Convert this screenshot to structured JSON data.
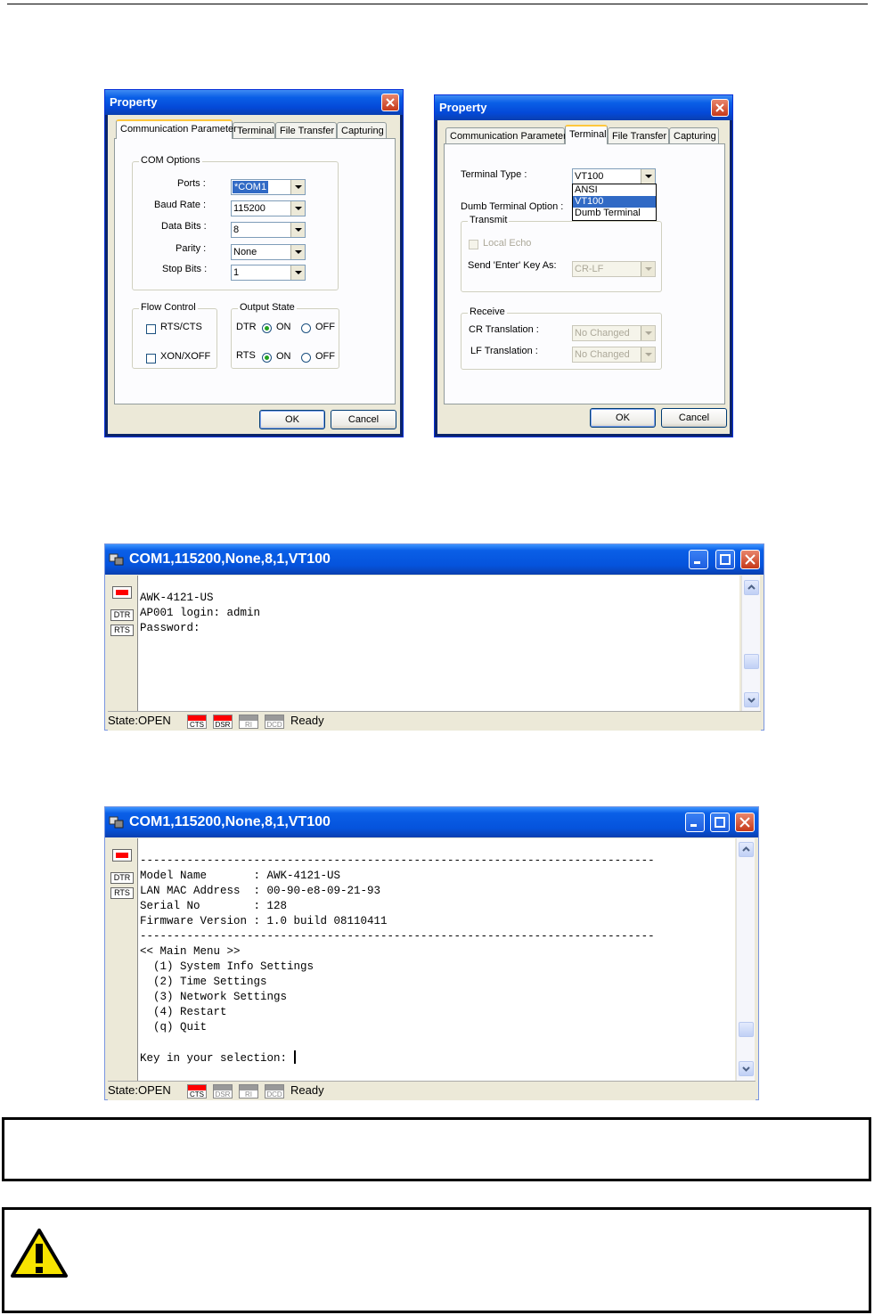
{
  "dialog1": {
    "title": "Property",
    "tabs": [
      "Communication Parameter",
      "Terminal",
      "File Transfer",
      "Capturing"
    ],
    "com_options_label": "COM Options",
    "ports_label": "Ports :",
    "ports_value": "*COM1",
    "baud_label": "Baud Rate :",
    "baud_value": "115200",
    "databits_label": "Data Bits :",
    "databits_value": "8",
    "parity_label": "Parity :",
    "parity_value": "None",
    "stopbits_label": "Stop Bits :",
    "stopbits_value": "1",
    "flow_label": "Flow Control",
    "rtscts_label": "RTS/CTS",
    "xonxoff_label": "XON/XOFF",
    "output_label": "Output State",
    "dtr_label": "DTR",
    "rts_label": "RTS",
    "on_label": "ON",
    "off_label": "OFF",
    "ok": "OK",
    "cancel": "Cancel"
  },
  "dialog2": {
    "title": "Property",
    "tabs": [
      "Communication Parameter",
      "Terminal",
      "File Transfer",
      "Capturing"
    ],
    "terminal_type_label": "Terminal Type :",
    "terminal_type_value": "VT100",
    "terminal_options": [
      "ANSI",
      "VT100",
      "Dumb Terminal"
    ],
    "dumb_label": "Dumb Terminal Option :",
    "transmit_label": "Transmit",
    "local_echo": "Local Echo",
    "send_enter_label": "Send 'Enter' Key  As:",
    "send_enter_value": "CR-LF",
    "receive_label": "Receive",
    "cr_label": "CR Translation :",
    "cr_value": "No Changed",
    "lf_label": "LF Translation :",
    "lf_value": "No Changed",
    "ok": "OK",
    "cancel": "Cancel"
  },
  "term1": {
    "title": "COM1,115200,None,8,1,VT100",
    "lines": [
      "",
      "AWK-4121-US",
      "AP001 login: admin",
      "Password:"
    ],
    "dtr": "DTR",
    "rts": "RTS",
    "state": "State:OPEN",
    "indicators": [
      "CTS",
      "DSR",
      "RI",
      "DCD"
    ],
    "ready": "Ready"
  },
  "term2": {
    "title": "COM1,115200,None,8,1,VT100",
    "lines": [
      "",
      "-----------------------------------------------------------------------------",
      "Model Name       : AWK-4121-US",
      "LAN MAC Address  : 00-90-e8-09-21-93",
      "Serial No        : 128",
      "Firmware Version : 1.0 build 08110411",
      "-----------------------------------------------------------------------------",
      "<< Main Menu >>",
      "  (1) System Info Settings",
      "  (2) Time Settings",
      "  (3) Network Settings",
      "  (4) Restart",
      "  (q) Quit",
      "",
      "Key in your selection: "
    ],
    "dtr": "DTR",
    "rts": "RTS",
    "state": "State:OPEN",
    "indicators": [
      "CTS",
      "DSR",
      "RI",
      "DCD"
    ],
    "ready": "Ready"
  },
  "colors": {
    "xp_blue": "#0553dc",
    "dialog_bg": "#ece9d8",
    "led_red": "#ff0000"
  },
  "icons": [
    "close-icon",
    "minimize-icon",
    "maximize-icon",
    "warning-icon",
    "app-icon",
    "dropdown-arrow-icon"
  ]
}
